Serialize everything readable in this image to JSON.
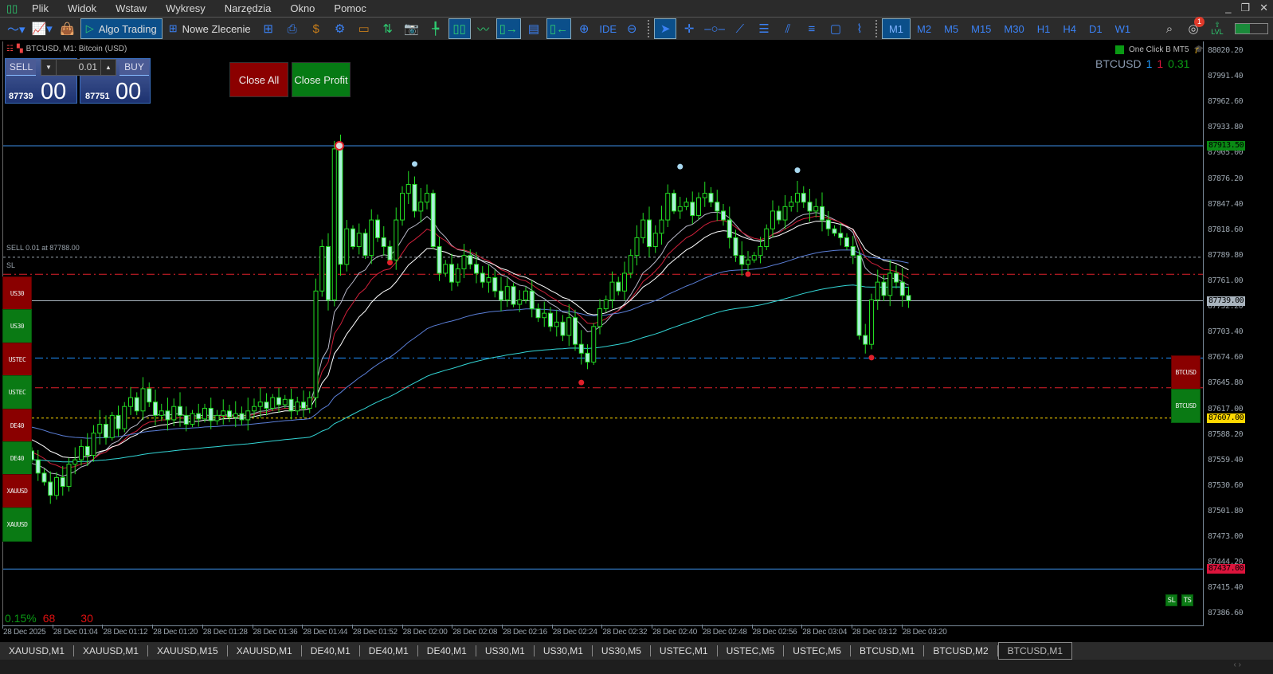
{
  "menu": [
    "Plik",
    "Widok",
    "Wstaw",
    "Wykresy",
    "Narzędzia",
    "Okno",
    "Pomoc"
  ],
  "toolbar": {
    "algo_trading": "Algo Trading",
    "new_order": "Nowe Zlecenie",
    "ide": "IDE",
    "timeframes": [
      "M1",
      "M2",
      "M5",
      "M15",
      "M30",
      "H1",
      "H4",
      "D1",
      "W1"
    ],
    "active_timeframe": "M1",
    "notification_count": "1",
    "lvl": "LVL"
  },
  "chart": {
    "title": "BTCUSD, M1:  Bitcoin (USD)"
  },
  "trade_panel": {
    "sell": "SELL",
    "buy": "BUY",
    "lot": "0.01",
    "sell_price_main": "87739",
    "sell_price_big": "00",
    "buy_price_main": "87751",
    "buy_price_big": "00"
  },
  "buttons": {
    "close_all": "Close All",
    "close_profit": "Close Profit",
    "sl": "SL",
    "ts": "TS"
  },
  "ea": {
    "name": "One Click B MT5",
    "symbol": "BTCUSD",
    "v1": "1",
    "v2": "1",
    "v3": "0.31"
  },
  "left_symbols": [
    {
      "label": "US30",
      "color": "red"
    },
    {
      "label": "US30",
      "color": "green"
    },
    {
      "label": "USTEC",
      "color": "red"
    },
    {
      "label": "USTEC",
      "color": "green"
    },
    {
      "label": "DE40",
      "color": "red"
    },
    {
      "label": "DE40",
      "color": "green"
    },
    {
      "label": "XAUUSD",
      "color": "red"
    },
    {
      "label": "XAUUSD",
      "color": "green"
    }
  ],
  "right_symbols": [
    {
      "label": "BTCUSD",
      "color": "red"
    },
    {
      "label": "BTCUSD",
      "color": "green"
    }
  ],
  "stats": {
    "pct": "0.15%",
    "a": "68",
    "b": "30"
  },
  "lines": {
    "sell_label": "SELL 0.01 at 87788.00",
    "sl_label": "SL"
  },
  "price_tags": [
    {
      "text": "87913.50",
      "price": 87913.5,
      "bg": "#0a8a14",
      "fg": "#000"
    },
    {
      "text": "87739.00",
      "price": 87739,
      "bg": "#a9b4be",
      "fg": "#000"
    },
    {
      "text": "87607.00",
      "price": 87607,
      "bg": "#ffd700",
      "fg": "#000"
    },
    {
      "text": "87437.00",
      "price": 87437,
      "bg": "#dc143c",
      "fg": "#000"
    }
  ],
  "tabs": [
    "XAUUSD,M1",
    "XAUUSD,M1",
    "XAUUSD,M15",
    "XAUUSD,M1",
    "DE40,M1",
    "DE40,M1",
    "DE40,M1",
    "US30,M1",
    "US30,M1",
    "US30,M5",
    "USTEC,M1",
    "USTEC,M5",
    "USTEC,M5",
    "BTCUSD,M1",
    "BTCUSD,M2",
    "BTCUSD,M1"
  ],
  "active_tab": 15,
  "chart_data": {
    "type": "candlestick",
    "symbol": "BTCUSD",
    "timeframe": "M1",
    "y_ticks": [
      "88020.20",
      "87991.40",
      "87962.60",
      "87933.80",
      "87905.00",
      "87876.20",
      "87847.40",
      "87818.60",
      "87789.80",
      "87761.00",
      "87732.20",
      "87703.40",
      "87674.60",
      "87645.80",
      "87617.00",
      "87588.20",
      "87559.40",
      "87530.60",
      "87501.80",
      "87473.00",
      "87444.20",
      "87415.40",
      "87386.60"
    ],
    "x_ticks": [
      "28 Dec 2025",
      "28 Dec 01:04",
      "28 Dec 01:12",
      "28 Dec 01:20",
      "28 Dec 01:28",
      "28 Dec 01:36",
      "28 Dec 01:44",
      "28 Dec 01:52",
      "28 Dec 02:00",
      "28 Dec 02:08",
      "28 Dec 02:16",
      "28 Dec 02:24",
      "28 Dec 02:32",
      "28 Dec 02:40",
      "28 Dec 02:48",
      "28 Dec 02:56",
      "28 Dec 03:04",
      "28 Dec 03:12",
      "28 Dec 03:20"
    ],
    "ylim": [
      87370,
      88030
    ],
    "closes": [
      87560,
      87545,
      87535,
      87520,
      87540,
      87530,
      87555,
      87560,
      87575,
      87565,
      87590,
      87600,
      87585,
      87610,
      87595,
      87620,
      87630,
      87615,
      87640,
      87625,
      87610,
      87615,
      87605,
      87620,
      87610,
      87600,
      87612,
      87606,
      87618,
      87604,
      87610,
      87615,
      87608,
      87612,
      87605,
      87615,
      87620,
      87625,
      87618,
      87630,
      87622,
      87628,
      87615,
      87625,
      87618,
      87630,
      87750,
      87800,
      87740,
      87910,
      87780,
      87820,
      87800,
      87815,
      87790,
      87830,
      87810,
      87800,
      87785,
      87830,
      87860,
      87870,
      87840,
      87850,
      87860,
      87800,
      87770,
      87780,
      87760,
      87775,
      87790,
      87780,
      87770,
      87760,
      87765,
      87750,
      87740,
      87755,
      87735,
      87740,
      87750,
      87730,
      87720,
      87725,
      87710,
      87715,
      87700,
      87720,
      87690,
      87680,
      87670,
      87710,
      87730,
      87740,
      87760,
      87750,
      87770,
      87790,
      87810,
      87830,
      87800,
      87815,
      87830,
      87860,
      87840,
      87845,
      87850,
      87835,
      87855,
      87860,
      87850,
      87840,
      87830,
      87810,
      87790,
      87780,
      87785,
      87790,
      87800,
      87820,
      87840,
      87830,
      87845,
      87850,
      87860,
      87850,
      87840,
      87845,
      87830,
      87820,
      87815,
      87810,
      87800,
      87790,
      87700,
      87690,
      87740,
      87760,
      87745,
      87770,
      87760,
      87745,
      87739
    ],
    "hlines": [
      {
        "price": 87913.5,
        "color": "#3b8ee6",
        "style": "solid"
      },
      {
        "price": 87788,
        "color": "#9aa4ad",
        "style": "dash"
      },
      {
        "price": 87768.9,
        "color": "#e0202a",
        "style": "dashdot"
      },
      {
        "price": 87739,
        "color": "#a9b4be",
        "style": "solid"
      },
      {
        "price": 87674.6,
        "color": "#1e90ff",
        "style": "dashdot"
      },
      {
        "price": 87641,
        "color": "#e0202a",
        "style": "dashdot"
      },
      {
        "price": 87607,
        "color": "#ffd700",
        "style": "dash"
      },
      {
        "price": 87437,
        "color": "#3b8ee6",
        "style": "solid"
      }
    ],
    "moving_averages": [
      {
        "period": 10,
        "color": "#b8b8c8",
        "seed": 87555
      },
      {
        "period": 14,
        "color": "#d0203a",
        "seed": 87570
      },
      {
        "period": 20,
        "color": "#ffffff",
        "seed": 87585
      },
      {
        "period": 60,
        "color": "#5b7fd8",
        "seed": 87598
      },
      {
        "period": 110,
        "color": "#33d6d6",
        "seed": 87560
      }
    ],
    "markers": [
      {
        "i": 58,
        "price": 87782,
        "color": "#e0202a"
      },
      {
        "i": 89,
        "price": 87647,
        "color": "#e0202a"
      },
      {
        "i": 116,
        "price": 87769,
        "color": "#e0202a"
      },
      {
        "i": 136,
        "price": 87675,
        "color": "#e0202a"
      },
      {
        "i": 105,
        "price": 87890,
        "color": "#a8d8f0"
      },
      {
        "i": 124,
        "price": 87886,
        "color": "#a8d8f0"
      },
      {
        "i": 62,
        "price": 87893,
        "color": "#a8d8f0"
      }
    ]
  }
}
